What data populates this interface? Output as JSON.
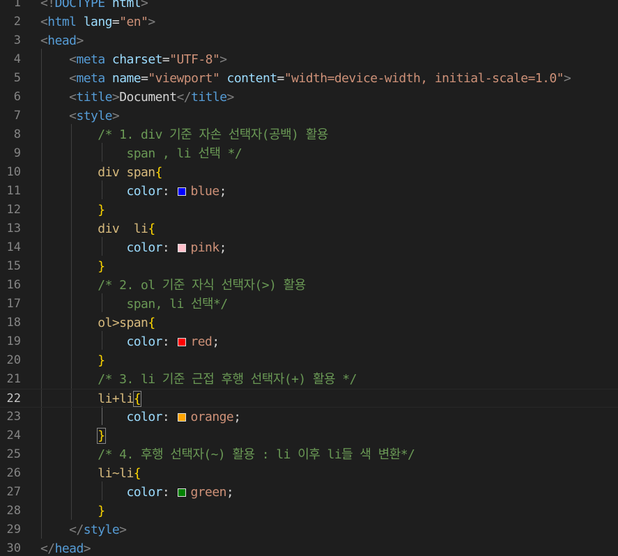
{
  "editor": {
    "current_line": 22,
    "lines": [
      {
        "n": "1",
        "tokens": [
          [
            "punc",
            "<!"
          ],
          [
            "kw",
            "DOCTYPE"
          ],
          [
            "txt",
            " "
          ],
          [
            "attr",
            "html"
          ],
          [
            "punc",
            ">"
          ]
        ]
      },
      {
        "n": "2",
        "tokens": [
          [
            "punc",
            "<"
          ],
          [
            "tag",
            "html"
          ],
          [
            "txt",
            " "
          ],
          [
            "attr",
            "lang"
          ],
          [
            "txt",
            "="
          ],
          [
            "str",
            "\"en\""
          ],
          [
            "punc",
            ">"
          ]
        ]
      },
      {
        "n": "3",
        "tokens": [
          [
            "punc",
            "<"
          ],
          [
            "tag",
            "head"
          ],
          [
            "punc",
            ">"
          ]
        ]
      },
      {
        "n": "4",
        "tokens": [
          [
            "txt",
            "    "
          ],
          [
            "punc",
            "<"
          ],
          [
            "tag",
            "meta"
          ],
          [
            "txt",
            " "
          ],
          [
            "attr",
            "charset"
          ],
          [
            "txt",
            "="
          ],
          [
            "str",
            "\"UTF-8\""
          ],
          [
            "punc",
            ">"
          ]
        ]
      },
      {
        "n": "5",
        "tokens": [
          [
            "txt",
            "    "
          ],
          [
            "punc",
            "<"
          ],
          [
            "tag",
            "meta"
          ],
          [
            "txt",
            " "
          ],
          [
            "attr",
            "name"
          ],
          [
            "txt",
            "="
          ],
          [
            "str",
            "\"viewport\""
          ],
          [
            "txt",
            " "
          ],
          [
            "attr",
            "content"
          ],
          [
            "txt",
            "="
          ],
          [
            "str",
            "\"width=device-width, initial-scale=1.0\""
          ],
          [
            "punc",
            ">"
          ]
        ]
      },
      {
        "n": "6",
        "tokens": [
          [
            "txt",
            "    "
          ],
          [
            "punc",
            "<"
          ],
          [
            "tag",
            "title"
          ],
          [
            "punc",
            ">"
          ],
          [
            "txt",
            "Document"
          ],
          [
            "punc",
            "</"
          ],
          [
            "tag",
            "title"
          ],
          [
            "punc",
            ">"
          ]
        ]
      },
      {
        "n": "7",
        "tokens": [
          [
            "txt",
            "    "
          ],
          [
            "punc",
            "<"
          ],
          [
            "tag",
            "style"
          ],
          [
            "punc",
            ">"
          ]
        ]
      },
      {
        "n": "8",
        "tokens": [
          [
            "txt",
            "        "
          ],
          [
            "com",
            "/* 1. div 기준 자손 선택자(공백) 활용"
          ]
        ]
      },
      {
        "n": "9",
        "tokens": [
          [
            "txt",
            "            "
          ],
          [
            "com",
            "span , li 선택 */"
          ]
        ]
      },
      {
        "n": "10",
        "tokens": [
          [
            "txt",
            "        "
          ],
          [
            "sel",
            "div span"
          ],
          [
            "brace",
            "{"
          ]
        ]
      },
      {
        "n": "11",
        "tokens": [
          [
            "txt",
            "            "
          ],
          [
            "prop",
            "color"
          ],
          [
            "txt",
            ": "
          ],
          [
            "swatch",
            "#0000ff"
          ],
          [
            "val",
            "blue"
          ],
          [
            "txt",
            ";"
          ]
        ]
      },
      {
        "n": "12",
        "tokens": [
          [
            "txt",
            "        "
          ],
          [
            "brace",
            "}"
          ]
        ]
      },
      {
        "n": "13",
        "tokens": [
          [
            "txt",
            "        "
          ],
          [
            "sel",
            "div  li"
          ],
          [
            "brace",
            "{"
          ]
        ]
      },
      {
        "n": "14",
        "tokens": [
          [
            "txt",
            "            "
          ],
          [
            "prop",
            "color"
          ],
          [
            "txt",
            ": "
          ],
          [
            "swatch",
            "#ffc0cb"
          ],
          [
            "val",
            "pink"
          ],
          [
            "txt",
            ";"
          ]
        ]
      },
      {
        "n": "15",
        "tokens": [
          [
            "txt",
            "        "
          ],
          [
            "brace",
            "}"
          ]
        ]
      },
      {
        "n": "16",
        "tokens": [
          [
            "txt",
            "        "
          ],
          [
            "com",
            "/* 2. ol 기준 자식 선택자(>) 활용"
          ]
        ]
      },
      {
        "n": "17",
        "tokens": [
          [
            "txt",
            "            "
          ],
          [
            "com",
            "span, li 선택*/"
          ]
        ]
      },
      {
        "n": "18",
        "tokens": [
          [
            "txt",
            "        "
          ],
          [
            "sel",
            "ol>span"
          ],
          [
            "brace",
            "{"
          ]
        ]
      },
      {
        "n": "19",
        "tokens": [
          [
            "txt",
            "            "
          ],
          [
            "prop",
            "color"
          ],
          [
            "txt",
            ": "
          ],
          [
            "swatch",
            "#ff0000"
          ],
          [
            "val",
            "red"
          ],
          [
            "txt",
            ";"
          ]
        ]
      },
      {
        "n": "20",
        "tokens": [
          [
            "txt",
            "        "
          ],
          [
            "brace",
            "}"
          ]
        ]
      },
      {
        "n": "21",
        "tokens": [
          [
            "txt",
            "        "
          ],
          [
            "com",
            "/* 3. li 기준 근접 후행 선택자(+) 활용 */"
          ]
        ]
      },
      {
        "n": "22",
        "tokens": [
          [
            "txt",
            "        "
          ],
          [
            "sel",
            "li+li"
          ],
          [
            "bracem",
            "{"
          ]
        ]
      },
      {
        "n": "23",
        "tokens": [
          [
            "txt",
            "            "
          ],
          [
            "prop",
            "color"
          ],
          [
            "txt",
            ": "
          ],
          [
            "swatch",
            "#ffa500"
          ],
          [
            "val",
            "orange"
          ],
          [
            "txt",
            ";"
          ]
        ]
      },
      {
        "n": "24",
        "tokens": [
          [
            "txt",
            "        "
          ],
          [
            "bracem",
            "}"
          ]
        ]
      },
      {
        "n": "25",
        "tokens": [
          [
            "txt",
            "        "
          ],
          [
            "com",
            "/* 4. 후행 선택자(~) 활용 : li 이후 li들 색 변환*/"
          ]
        ]
      },
      {
        "n": "26",
        "tokens": [
          [
            "txt",
            "        "
          ],
          [
            "sel",
            "li~li"
          ],
          [
            "brace",
            "{"
          ]
        ]
      },
      {
        "n": "27",
        "tokens": [
          [
            "txt",
            "            "
          ],
          [
            "prop",
            "color"
          ],
          [
            "txt",
            ": "
          ],
          [
            "swatch",
            "#008000"
          ],
          [
            "val",
            "green"
          ],
          [
            "txt",
            ";"
          ]
        ]
      },
      {
        "n": "28",
        "tokens": [
          [
            "txt",
            "        "
          ],
          [
            "brace",
            "}"
          ]
        ]
      },
      {
        "n": "29",
        "tokens": [
          [
            "txt",
            "    "
          ],
          [
            "punc",
            "</"
          ],
          [
            "tag",
            "style"
          ],
          [
            "punc",
            ">"
          ]
        ]
      },
      {
        "n": "30",
        "tokens": [
          [
            "punc",
            "</"
          ],
          [
            "tag",
            "head"
          ],
          [
            "punc",
            ">"
          ]
        ]
      }
    ]
  }
}
